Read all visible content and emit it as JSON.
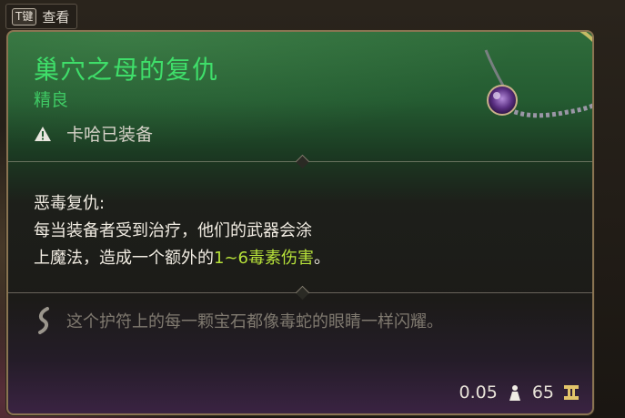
{
  "hint": {
    "key": "T键",
    "label": "查看"
  },
  "item": {
    "name": "巢穴之母的复仇",
    "rarity": "精良",
    "equipped_note": "卡哈已装备",
    "effect": {
      "name": "恶毒复仇:",
      "line1": "每当装备者受到治疗，他们的武器会涂",
      "line2_prefix": "上魔法，造成一个额外的",
      "line2_highlight": "1~6毒素伤害",
      "line2_suffix": "。"
    },
    "flavor": "这个护符上的每一颗宝石都像毒蛇的眼睛一样闪耀。",
    "weight": "0.05",
    "value": "65"
  },
  "colors": {
    "title": "#3fde6a",
    "highlight": "#b7e23a",
    "border": "#8a7452"
  },
  "icons": [
    "warning-icon",
    "feather-icon",
    "weight-icon",
    "gold-icon",
    "amulet-image"
  ]
}
